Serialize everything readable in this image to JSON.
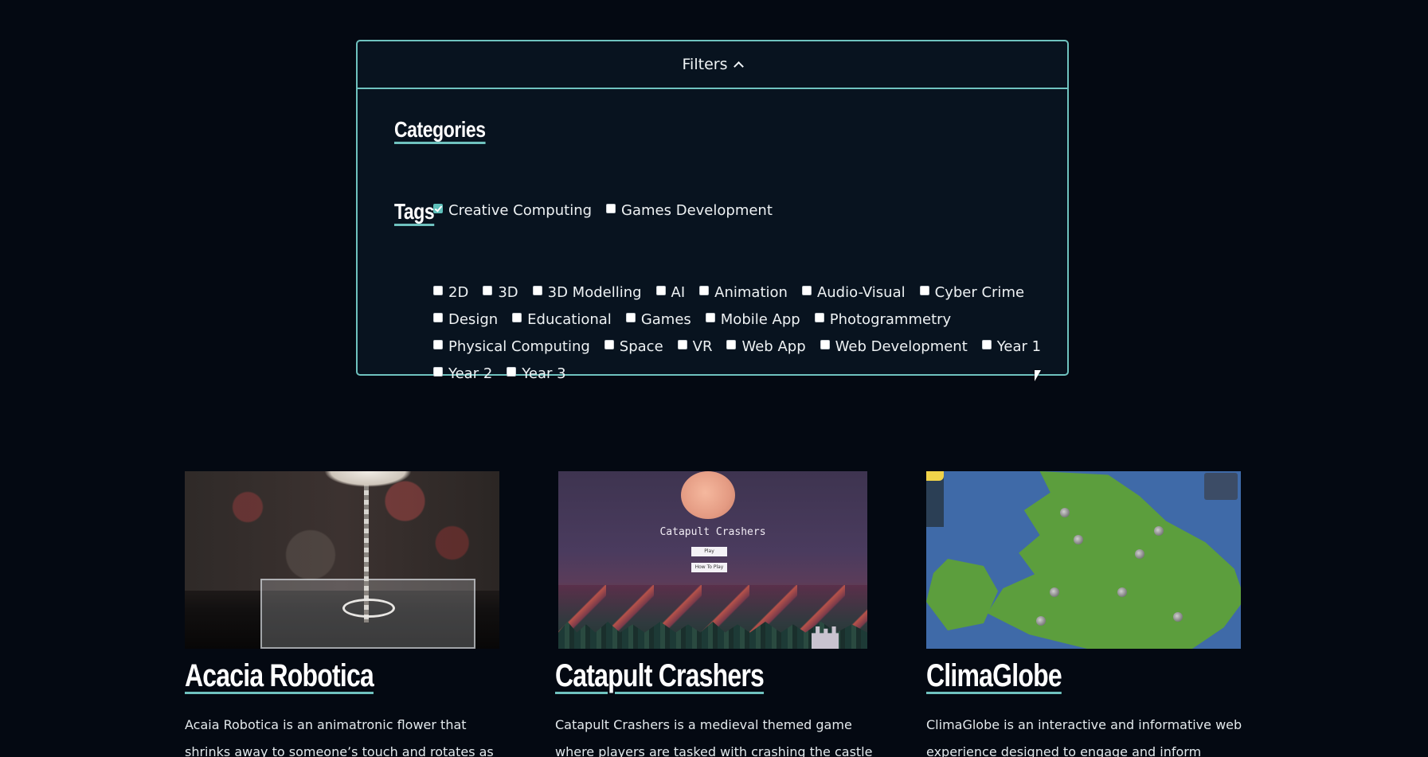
{
  "filters": {
    "toggle_label": "Filters",
    "categories_title": "Categories",
    "tags_title": "Tags",
    "categories": [
      {
        "label": "Creative Computing",
        "checked": true
      },
      {
        "label": "Games Development",
        "checked": false
      }
    ],
    "tags": [
      {
        "label": "2D",
        "checked": false
      },
      {
        "label": "3D",
        "checked": false
      },
      {
        "label": "3D Modelling",
        "checked": false
      },
      {
        "label": "AI",
        "checked": false
      },
      {
        "label": "Animation",
        "checked": false
      },
      {
        "label": "Audio-Visual",
        "checked": false
      },
      {
        "label": "Cyber Crime",
        "checked": false
      },
      {
        "label": "Design",
        "checked": false
      },
      {
        "label": "Educational",
        "checked": false
      },
      {
        "label": "Games",
        "checked": false
      },
      {
        "label": "Mobile App",
        "checked": false
      },
      {
        "label": "Photogrammetry",
        "checked": false
      },
      {
        "label": "Physical Computing",
        "checked": false
      },
      {
        "label": "Space",
        "checked": false
      },
      {
        "label": "VR",
        "checked": false
      },
      {
        "label": "Web App",
        "checked": false
      },
      {
        "label": "Web Development",
        "checked": false
      },
      {
        "label": "Year 1",
        "checked": false
      },
      {
        "label": "Year 2",
        "checked": false
      },
      {
        "label": "Year 3",
        "checked": false
      }
    ]
  },
  "projects": [
    {
      "title": "Acacia Robotica",
      "description": "Acaia Robotica is an animatronic flower that shrinks away to someone’s touch and rotates as if dancing.",
      "thumbnail_icon": "robotic-flower-image"
    },
    {
      "title": "Catapult Crashers",
      "description": "Catapult Crashers is a medieval themed game where players are tasked with crashing the castle",
      "thumbnail_icon": "catapult-game-image",
      "thumbnail_text": "Catapult Crashers",
      "thumbnail_buttons": [
        "Play",
        "How To Play"
      ]
    },
    {
      "title": "ClimaGlobe",
      "description": "ClimaGlobe is an interactive and informative web experience designed to engage and inform people",
      "thumbnail_icon": "uk-map-image"
    }
  ],
  "colors": {
    "accent": "#6fc2bf",
    "background": "#040912",
    "panel": "#08131f"
  }
}
